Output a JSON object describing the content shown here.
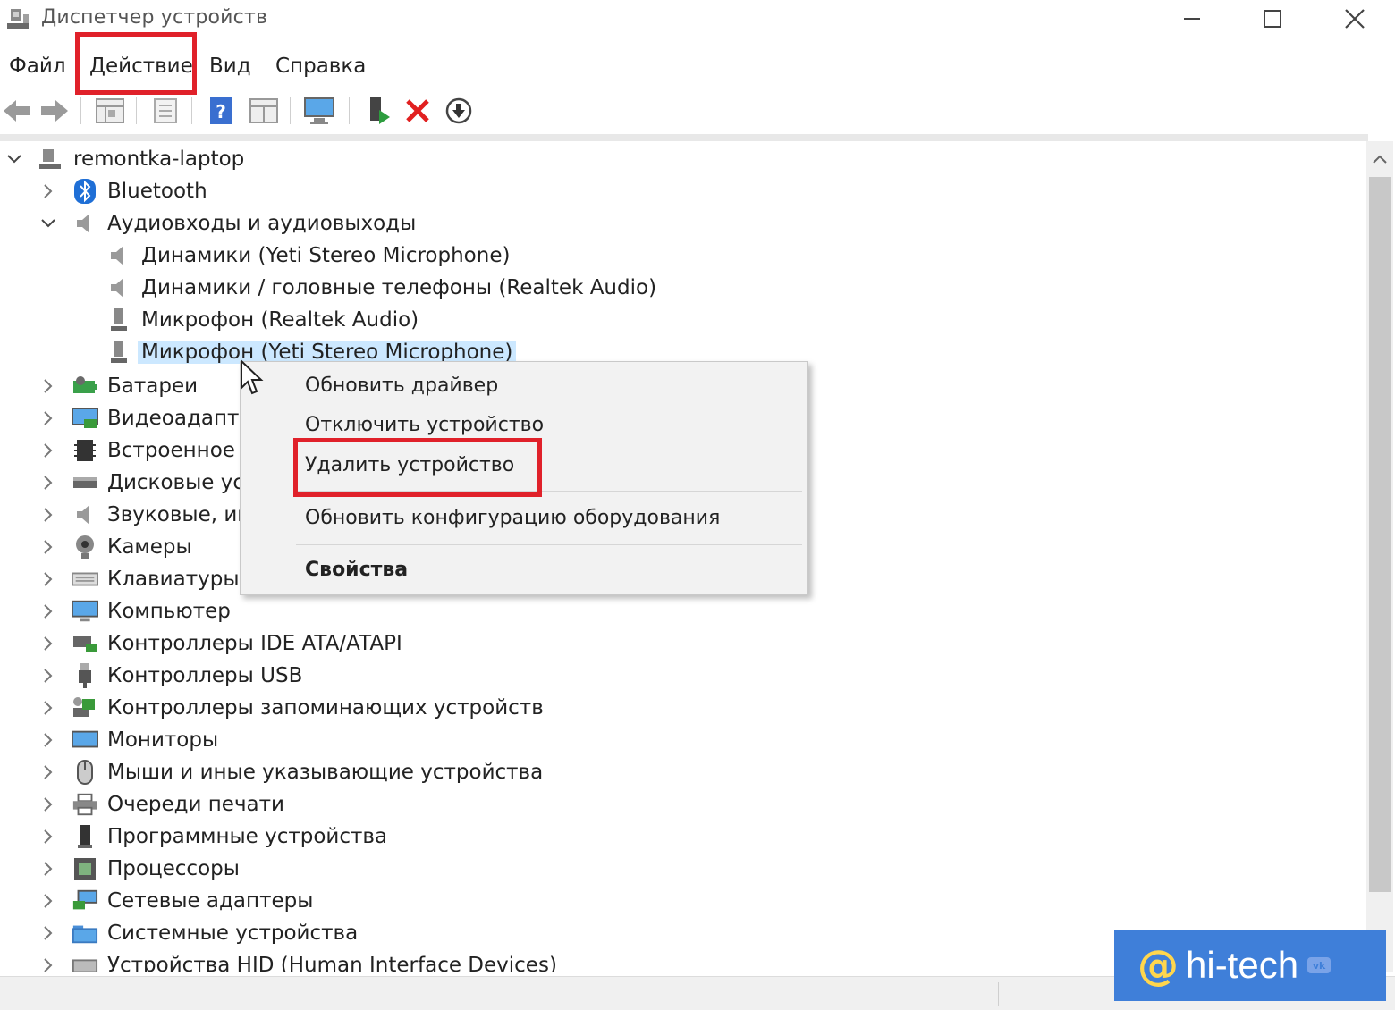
{
  "window": {
    "title": "Диспетчер устройств"
  },
  "menu": {
    "items": [
      {
        "label": "Файл"
      },
      {
        "label": "Действие"
      },
      {
        "label": "Вид"
      },
      {
        "label": "Справка"
      }
    ]
  },
  "toolbar": {
    "icons": [
      "back-arrow-icon",
      "forward-arrow-icon",
      "properties-grid-icon",
      "list-icon",
      "help-icon",
      "view-grid-icon",
      "monitor-icon",
      "enable-device-icon",
      "delete-device-icon",
      "update-driver-icon"
    ]
  },
  "tree": {
    "root": "remontka-laptop",
    "rows": [
      {
        "label": "Bluetooth"
      },
      {
        "label": "Аудиовходы и аудиовыходы"
      },
      {
        "label": "Динамики (Yeti Stereo Microphone)"
      },
      {
        "label": "Динамики / головные телефоны (Realtek Audio)"
      },
      {
        "label": "Микрофон (Realtek Audio)"
      },
      {
        "label": "Микрофон (Yeti Stereo Microphone)"
      },
      {
        "label": "Батареи"
      },
      {
        "label": "Видеоадаптер"
      },
      {
        "label": "Встроенное П"
      },
      {
        "label": "Дисковые уст"
      },
      {
        "label": "Звуковые, игр"
      },
      {
        "label": "Камеры"
      },
      {
        "label": "Клавиатуры"
      },
      {
        "label": "Компьютер"
      },
      {
        "label": "Контроллеры IDE ATA/ATAPI"
      },
      {
        "label": "Контроллеры USB"
      },
      {
        "label": "Контроллеры запоминающих устройств"
      },
      {
        "label": "Мониторы"
      },
      {
        "label": "Мыши и иные указывающие устройства"
      },
      {
        "label": "Очереди печати"
      },
      {
        "label": "Программные устройства"
      },
      {
        "label": "Процессоры"
      },
      {
        "label": "Сетевые адаптеры"
      },
      {
        "label": "Системные устройства"
      },
      {
        "label": "Устройства HID (Human Interface Devices)"
      }
    ]
  },
  "context_menu": {
    "update_driver": "Обновить драйвер",
    "disable_device": "Отключить устройство",
    "uninstall_device": "Удалить устройство",
    "scan_hardware": "Обновить конфигурацию оборудования",
    "properties": "Свойства"
  },
  "watermark": {
    "at": "@",
    "text": "hi-tech",
    "vk": "vk"
  },
  "colors": {
    "highlight": "#e0212a",
    "selection": "#cce8ff",
    "watermark_bg": "#3f7fd9"
  }
}
